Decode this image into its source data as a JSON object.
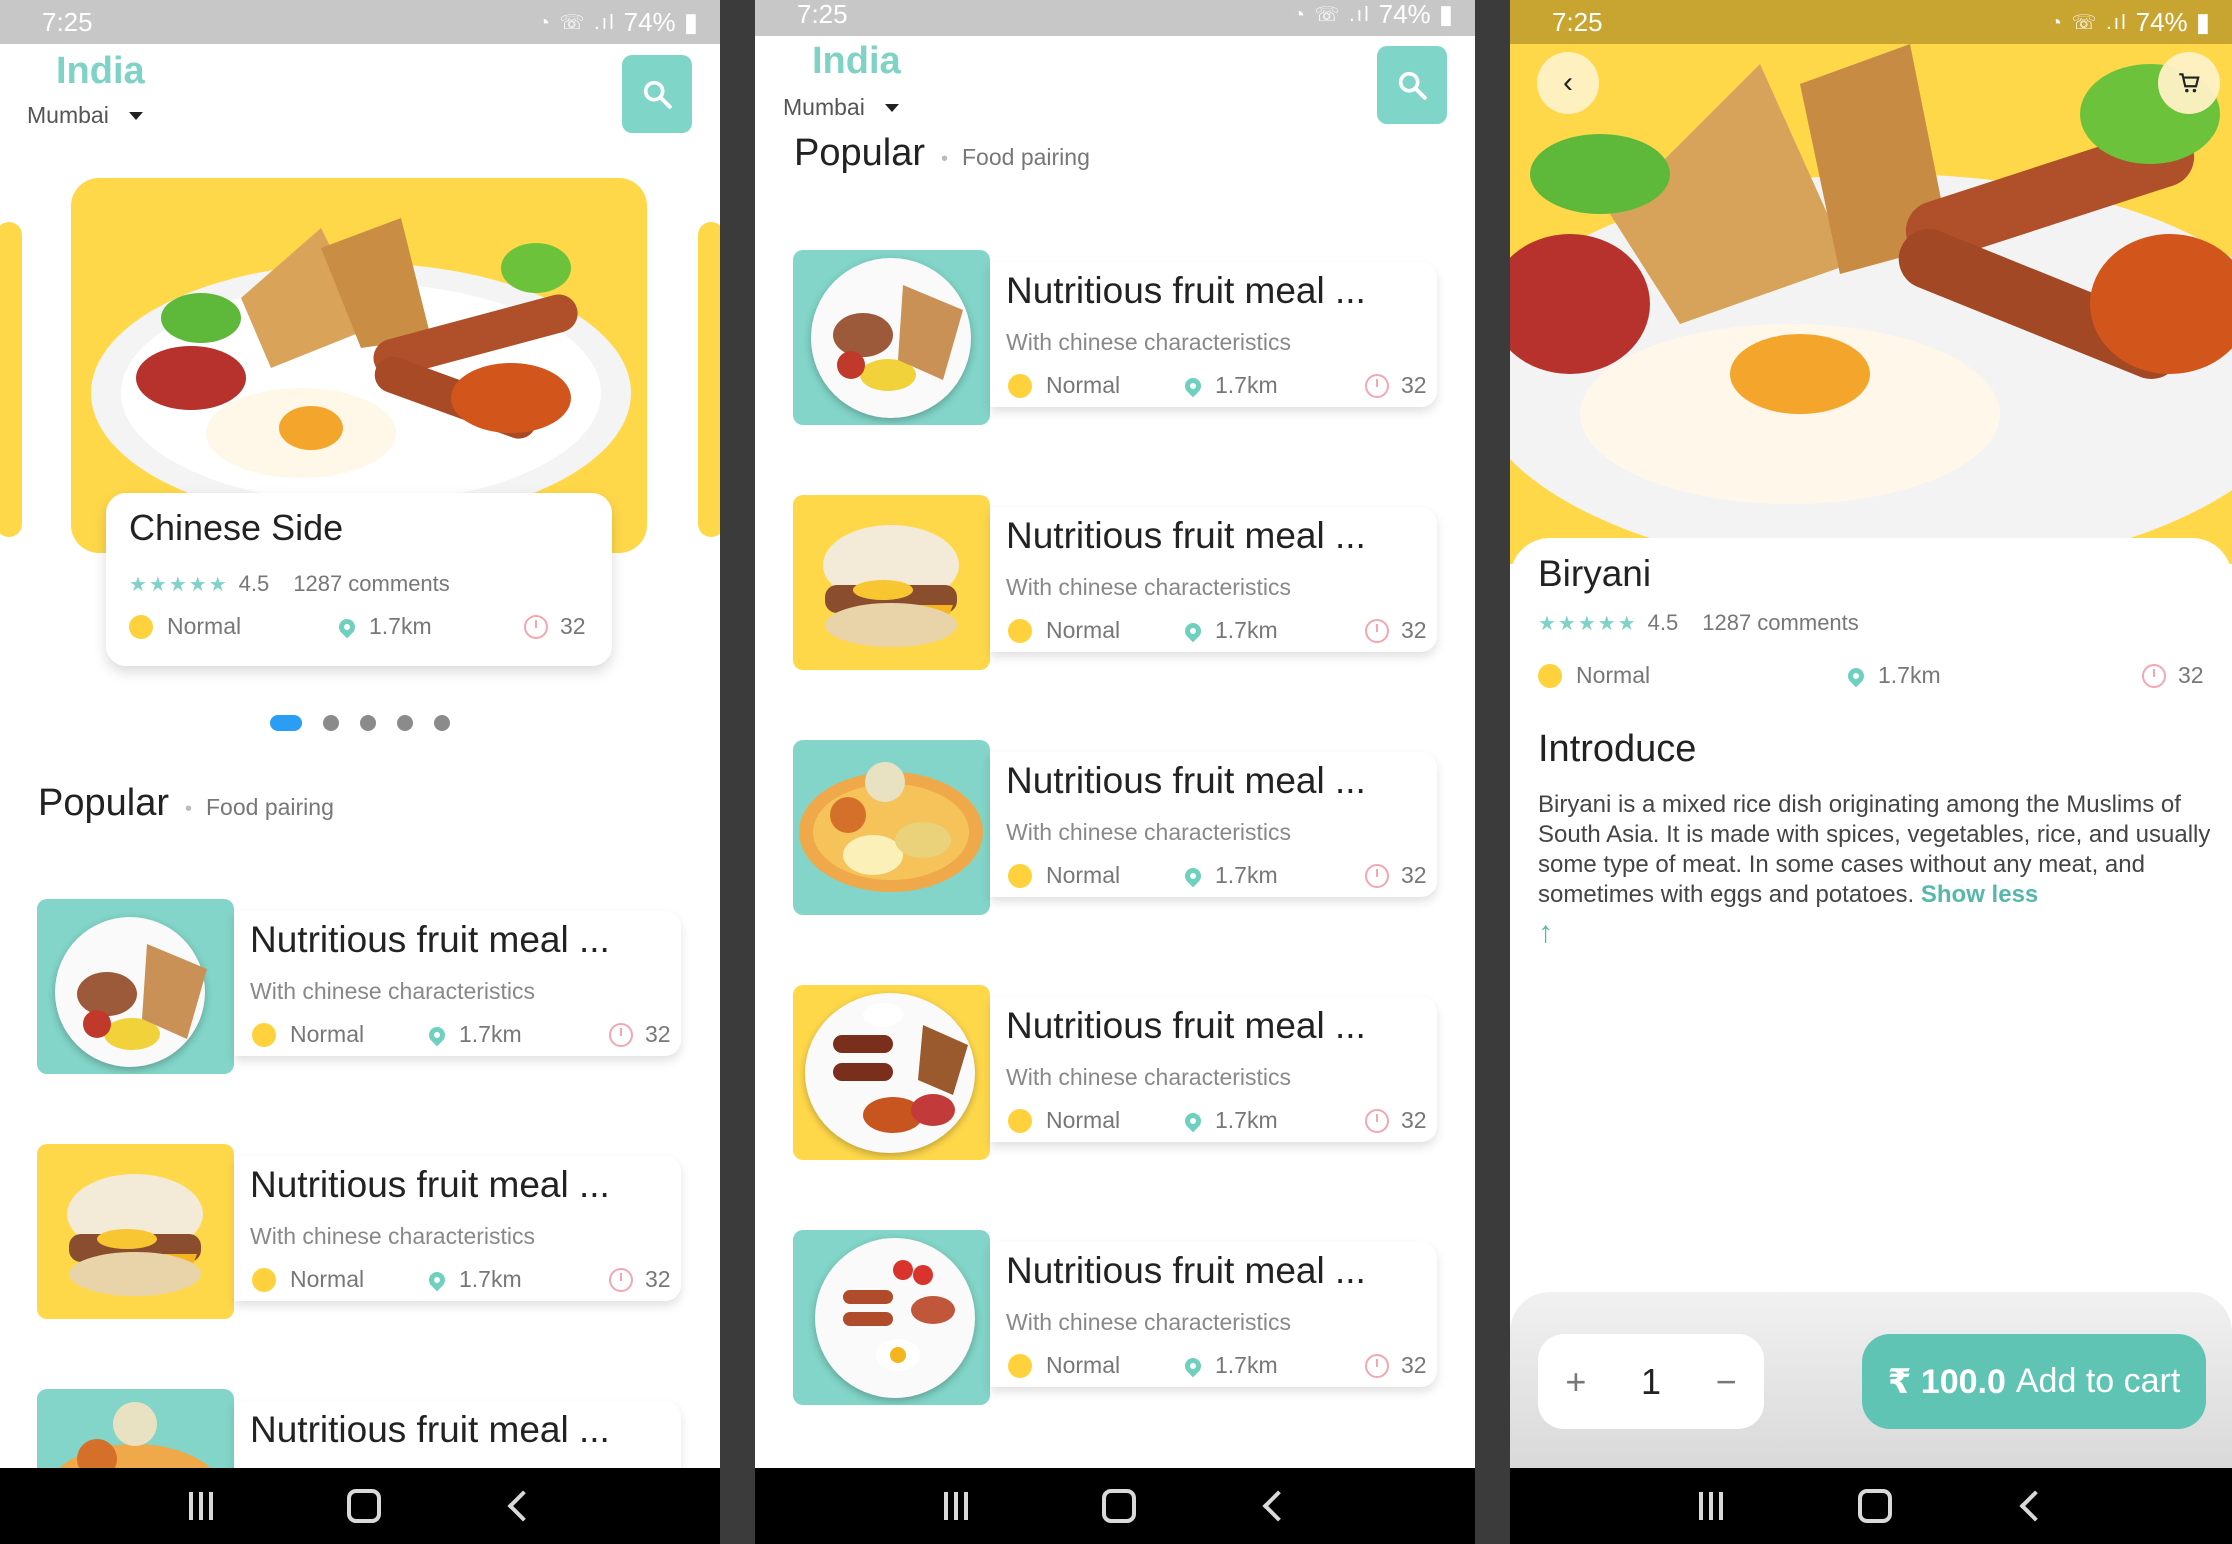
{
  "status": {
    "time": "7:25",
    "battery": "74%"
  },
  "location": {
    "country": "India",
    "city": "Mumbai"
  },
  "icons": {
    "search": "search-icon",
    "back": "chevron-left-icon",
    "cart": "cart-icon",
    "normal": "yellow-dot-icon",
    "distance": "location-pin-icon",
    "time": "clock-icon"
  },
  "colors": {
    "accent": "#7fd3c6",
    "yellow": "#ffd84a",
    "button": "#5fc4b4"
  },
  "hero": {
    "title": "Chinese Side",
    "rating": "4.5",
    "comments": "1287 comments",
    "level": "Normal",
    "distance": "1.7km",
    "time": "32"
  },
  "pager": {
    "count": 5,
    "active": 0
  },
  "popular": {
    "heading": "Popular",
    "subheading": "Food pairing"
  },
  "items": [
    {
      "title": "Nutritious fruit meal ...",
      "subtitle": "With chinese characteristics",
      "level": "Normal",
      "distance": "1.7km",
      "time": "32"
    },
    {
      "title": "Nutritious fruit meal ...",
      "subtitle": "With chinese characteristics",
      "level": "Normal",
      "distance": "1.7km",
      "time": "32"
    },
    {
      "title": "Nutritious fruit meal ...",
      "subtitle": "With chinese characteristics",
      "level": "Normal",
      "distance": "1.7km",
      "time": "32"
    },
    {
      "title": "Nutritious fruit meal ...",
      "subtitle": "With chinese characteristics",
      "level": "Normal",
      "distance": "1.7km",
      "time": "32"
    },
    {
      "title": "Nutritious fruit meal ...",
      "subtitle": "With chinese characteristics",
      "level": "Normal",
      "distance": "1.7km",
      "time": "32"
    }
  ],
  "detail": {
    "title": "Biryani",
    "rating": "4.5",
    "comments": "1287 comments",
    "level": "Normal",
    "distance": "1.7km",
    "time": "32",
    "section": "Introduce",
    "description": "Biryani is a mixed rice dish originating among the Muslims of South Asia. It is made with spices, vegetables, rice, and usually some type of meat. In some cases without any meat, and sometimes with eggs and potatoes.",
    "show_less": "Show less",
    "quantity": "1",
    "plus": "+",
    "minus": "−",
    "price": "₹ 100.0",
    "add_label": "Add to cart"
  }
}
